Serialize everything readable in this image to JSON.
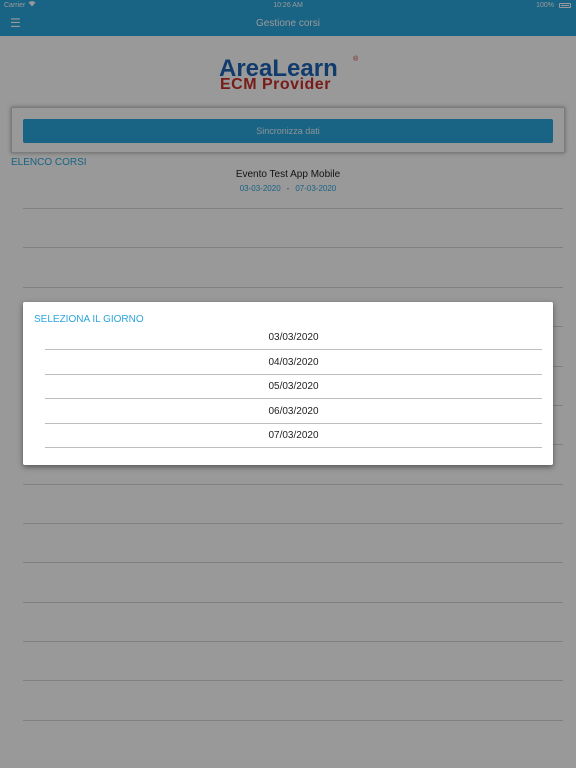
{
  "status_bar": {
    "carrier": "Carrier",
    "time": "10:26 AM",
    "battery": "100%"
  },
  "navbar": {
    "title": "Gestione corsi",
    "menu_glyph": "☰"
  },
  "logo": {
    "line1_a": "Area",
    "line1_b": "Learn",
    "line2": "ECM Provider",
    "registered": "®"
  },
  "sync": {
    "button_label": "Sincronizza dati"
  },
  "list": {
    "heading": "ELENCO CORSI",
    "event": {
      "title": "Evento Test App Mobile",
      "start": "03-03-2020",
      "sep": "-",
      "end": "07-03-2020"
    }
  },
  "dialog": {
    "title": "SELEZIONA IL GIORNO",
    "options": [
      "03/03/2020",
      "04/03/2020",
      "05/03/2020",
      "06/03/2020",
      "07/03/2020"
    ]
  },
  "colors": {
    "accent": "#2aa5dc",
    "logo_blue": "#1c63b4",
    "logo_red": "#c8302b"
  }
}
